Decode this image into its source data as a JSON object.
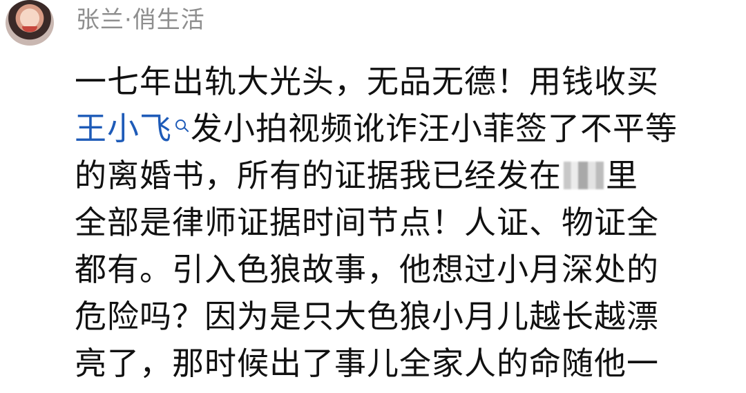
{
  "post": {
    "author": "张兰·俏生活",
    "lines": [
      {
        "text": "一七年出轨大光头，无品无德！用钱收买"
      },
      {
        "mention": "王小飞",
        "icon": "search-icon",
        "text": "发小拍视频讹诈汪小菲签了不平等"
      },
      {
        "before_blur": "的离婚书，所有的证据我已经发在",
        "after_blur": "里"
      },
      {
        "text": "全部是律师证据时间节点！人证、物证全"
      },
      {
        "text": "都有。引入色狼故事，他想过小月深处的"
      },
      {
        "text": "危险吗？因为是只大色狼小月儿越长越漂"
      },
      {
        "text": "亮了，那时候出了事儿全家人的命随他一"
      }
    ]
  },
  "colors": {
    "mention": "#1e5bb8",
    "author": "#8e8e8e",
    "text": "#111111"
  }
}
